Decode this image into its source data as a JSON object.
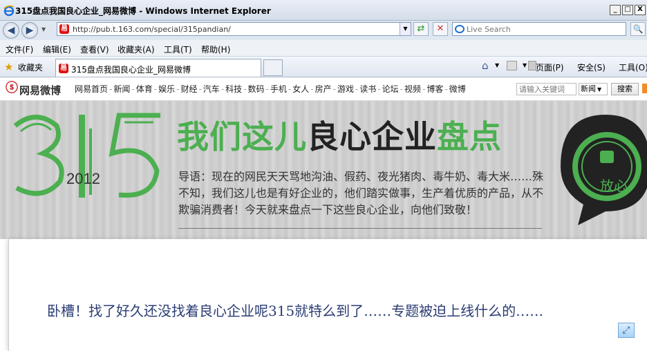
{
  "window": {
    "title": "315盘点我国良心企业_网易微博 - Windows Internet Explorer",
    "minimize": "_",
    "maximize": "□",
    "close": "X"
  },
  "address": {
    "url": "http://pub.t.163.com/special/315pandian/",
    "search_placeholder": "Live Search"
  },
  "menu": [
    "文件(F)",
    "编辑(E)",
    "查看(V)",
    "收藏夹(A)",
    "工具(T)",
    "帮助(H)"
  ],
  "favorites_label": "收藏夹",
  "tab": {
    "label": "315盘点我国良心企业_网易微博"
  },
  "commands": [
    "页面(P)",
    "安全(S)",
    "工具(O)"
  ],
  "site": {
    "logo": "网易微博",
    "nav": [
      "网易首页",
      "新闻",
      "体育",
      "娱乐",
      "财经",
      "汽车",
      "科技",
      "数码",
      "手机",
      "女人",
      "房产",
      "游戏",
      "读书",
      "论坛",
      "视频",
      "博客",
      "微博"
    ],
    "search_placeholder": "请输入关键词",
    "search_select": "新闻",
    "search_button": "搜索"
  },
  "banner": {
    "big_number": "315",
    "year": "2012",
    "headline_part1": "我们这儿",
    "headline_part2": "良心企业",
    "headline_part3": "盘点",
    "intro": "导语：现在的网民天天骂地沟油、假药、夜光猪肉、毒牛奶、毒大米……殊不知，我们这儿也是有好企业的，他们踏实做事，生产着优质的产品，从不欺骗消费者！今天就来盘点一下这些良心企业，向他们致敬！",
    "badge_text": "放心"
  },
  "content": {
    "line": "卧槽！找了好久还没找着良心企业呢315就特么到了……专题被迫上线什么的……"
  },
  "colors": {
    "accent_green": "#4caf50",
    "brand_red": "#c8161d",
    "content_blue": "#2a3c73"
  }
}
